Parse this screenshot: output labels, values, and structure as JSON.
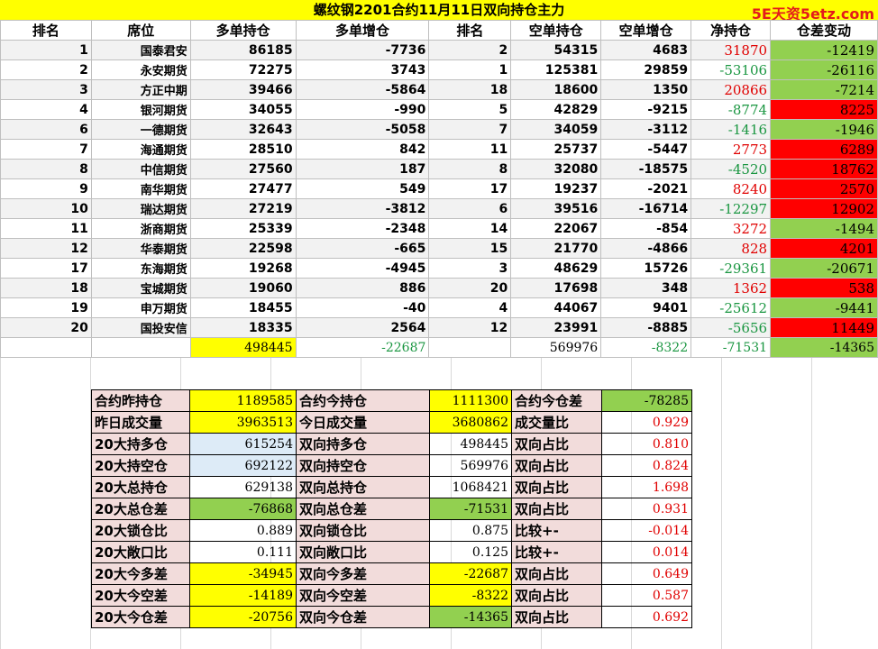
{
  "title": "螺纹钢2201合约11月11日双向持仓主力",
  "watermark": "5E天资5etz.com",
  "headers": [
    "排名",
    "席位",
    "多单持仓",
    "多单增仓",
    "排名",
    "空单持仓",
    "空单增仓",
    "净持仓",
    "仓差变动"
  ],
  "rows": [
    {
      "rank_long": "1",
      "broker": "国泰君安",
      "long": "86185",
      "long_chg": "-7736",
      "rank_short": "2",
      "short": "54315",
      "short_chg": "4683",
      "net": "31870",
      "diff": "-12419"
    },
    {
      "rank_long": "2",
      "broker": "永安期货",
      "long": "72275",
      "long_chg": "3743",
      "rank_short": "1",
      "short": "125381",
      "short_chg": "29859",
      "net": "-53106",
      "diff": "-26116"
    },
    {
      "rank_long": "3",
      "broker": "方正中期",
      "long": "39466",
      "long_chg": "-5864",
      "rank_short": "18",
      "short": "18600",
      "short_chg": "1350",
      "net": "20866",
      "diff": "-7214"
    },
    {
      "rank_long": "4",
      "broker": "银河期货",
      "long": "34055",
      "long_chg": "-990",
      "rank_short": "5",
      "short": "42829",
      "short_chg": "-9215",
      "net": "-8774",
      "diff": "8225"
    },
    {
      "rank_long": "6",
      "broker": "一德期货",
      "long": "32643",
      "long_chg": "-5058",
      "rank_short": "7",
      "short": "34059",
      "short_chg": "-3112",
      "net": "-1416",
      "diff": "-1946"
    },
    {
      "rank_long": "7",
      "broker": "海通期货",
      "long": "28510",
      "long_chg": "842",
      "rank_short": "11",
      "short": "25737",
      "short_chg": "-5447",
      "net": "2773",
      "diff": "6289"
    },
    {
      "rank_long": "8",
      "broker": "中信期货",
      "long": "27560",
      "long_chg": "187",
      "rank_short": "8",
      "short": "32080",
      "short_chg": "-18575",
      "net": "-4520",
      "diff": "18762"
    },
    {
      "rank_long": "9",
      "broker": "南华期货",
      "long": "27477",
      "long_chg": "549",
      "rank_short": "17",
      "short": "19237",
      "short_chg": "-2021",
      "net": "8240",
      "diff": "2570"
    },
    {
      "rank_long": "10",
      "broker": "瑞达期货",
      "long": "27219",
      "long_chg": "-3812",
      "rank_short": "6",
      "short": "39516",
      "short_chg": "-16714",
      "net": "-12297",
      "diff": "12902"
    },
    {
      "rank_long": "11",
      "broker": "浙商期货",
      "long": "25339",
      "long_chg": "-2348",
      "rank_short": "14",
      "short": "22067",
      "short_chg": "-854",
      "net": "3272",
      "diff": "-1494"
    },
    {
      "rank_long": "12",
      "broker": "华泰期货",
      "long": "22598",
      "long_chg": "-665",
      "rank_short": "15",
      "short": "21770",
      "short_chg": "-4866",
      "net": "828",
      "diff": "4201"
    },
    {
      "rank_long": "17",
      "broker": "东海期货",
      "long": "19268",
      "long_chg": "-4945",
      "rank_short": "3",
      "short": "48629",
      "short_chg": "15726",
      "net": "-29361",
      "diff": "-20671"
    },
    {
      "rank_long": "18",
      "broker": "宝城期货",
      "long": "19060",
      "long_chg": "886",
      "rank_short": "20",
      "short": "17698",
      "short_chg": "348",
      "net": "1362",
      "diff": "538"
    },
    {
      "rank_long": "19",
      "broker": "申万期货",
      "long": "18455",
      "long_chg": "-40",
      "rank_short": "4",
      "short": "44067",
      "short_chg": "9401",
      "net": "-25612",
      "diff": "-9441"
    },
    {
      "rank_long": "20",
      "broker": "国投安信",
      "long": "18335",
      "long_chg": "2564",
      "rank_short": "12",
      "short": "23991",
      "short_chg": "-8885",
      "net": "-5656",
      "diff": "11449"
    }
  ],
  "totals": {
    "long": "498445",
    "long_chg": "-22687",
    "short": "569976",
    "short_chg": "-8322",
    "net": "-71531",
    "diff": "-14365"
  },
  "summary": [
    {
      "l1": "合约昨持仓",
      "v1": "1189585",
      "l2": "合约今持仓",
      "v2": "1111300",
      "l3": "合约今仓差",
      "v3": "-78285"
    },
    {
      "l1": "昨日成交量",
      "v1": "3963513",
      "l2": "今日成交量",
      "v2": "3680862",
      "l3": "成交量比",
      "v3": "0.929"
    },
    {
      "l1": "20大持多仓",
      "v1": "615254",
      "l2": "双向持多仓",
      "v2": "498445",
      "l3": "双向占比",
      "v3": "0.810"
    },
    {
      "l1": "20大持空仓",
      "v1": "692122",
      "l2": "双向持空仓",
      "v2": "569976",
      "l3": "双向占比",
      "v3": "0.824"
    },
    {
      "l1": "20大总持仓",
      "v1": "629138",
      "l2": "双向总持仓",
      "v2": "1068421",
      "l3": "双向占比",
      "v3": "1.698"
    },
    {
      "l1": "20大总仓差",
      "v1": "-76868",
      "l2": "双向总仓差",
      "v2": "-71531",
      "l3": "双向占比",
      "v3": "0.931"
    },
    {
      "l1": "20大锁仓比",
      "v1": "0.889",
      "l2": "双向锁仓比",
      "v2": "0.875",
      "l3": "比较+-",
      "v3": "-0.014"
    },
    {
      "l1": "20大敞口比",
      "v1": "0.111",
      "l2": "双向敞口比",
      "v2": "0.125",
      "l3": "比较+-",
      "v3": "0.014"
    },
    {
      "l1": "20大今多差",
      "v1": "-34945",
      "l2": "双向今多差",
      "v2": "-22687",
      "l3": "双向占比",
      "v3": "0.649"
    },
    {
      "l1": "20大今空差",
      "v1": "-14189",
      "l2": "双向今空差",
      "v2": "-8322",
      "l3": "双向占比",
      "v3": "0.587"
    },
    {
      "l1": "20大今仓差",
      "v1": "-20756",
      "l2": "双向今仓差",
      "v2": "-14365",
      "l3": "双向占比",
      "v3": "0.692"
    }
  ],
  "colors": {
    "positive_text": "#e00000",
    "negative_text": "#1a9641",
    "increase_bg": "#ff0000",
    "decrease_bg": "#92d050",
    "highlight": "#ffff00",
    "label_bg": "#f2dcdb"
  }
}
